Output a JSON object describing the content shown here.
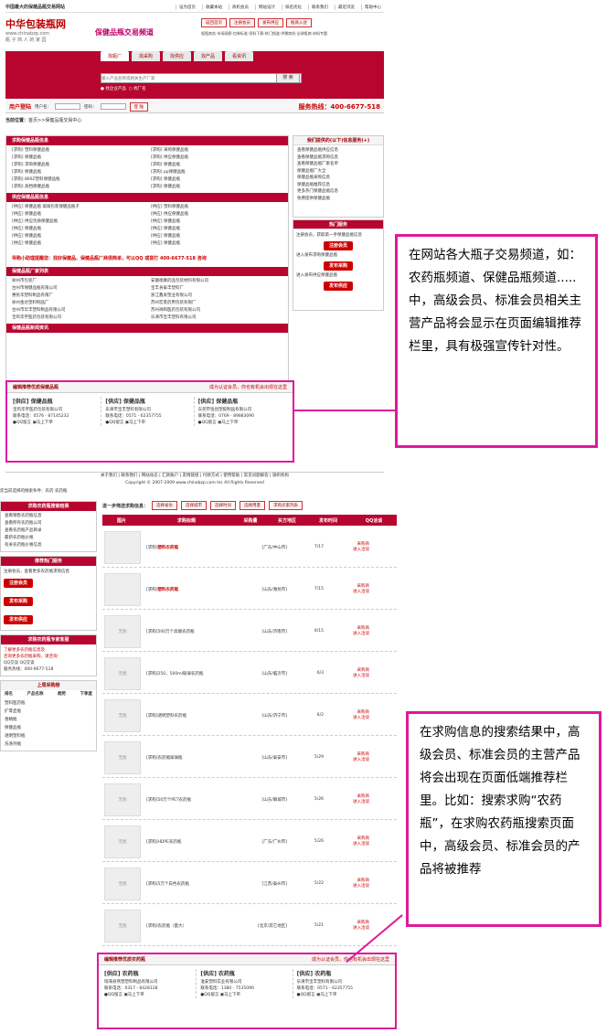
{
  "header": {
    "site_name": "中国最大的保健品瓶交易网站",
    "top_links": [
      "设为首页",
      "收藏本站",
      "商机会员",
      "网站设计",
      "排名优化",
      "联系我们",
      "最近浏览",
      "帮助中心"
    ],
    "logo_title": "中华包装瓶网",
    "logo_url": "www.chinabzp.com",
    "logo_slogan": "瓶 子 商 人 的 家 园",
    "channel": "保健品瓶交易频道",
    "buttons": [
      "返回首页",
      "注册会员",
      "发布供应",
      "瓶商入驻"
    ],
    "links_line": "瓶瓶商务-市场观察-包装标准-资料下载-热门频道-供需商机-全球瓶商-材料专题"
  },
  "nav": {
    "tabs": [
      "找瓶厂",
      "找采购",
      "找供应",
      "找产品",
      "看资讯"
    ],
    "search_placeholder": "输入产品名称或相关生产厂家",
    "search_btn": "搜 索",
    "radio1": "找企业产品",
    "radio2": "找厂名"
  },
  "login": {
    "title": "用户登陆",
    "user_label": "用户名：",
    "pass_label": "密码：",
    "submit": "登 陆",
    "hotline": "服务热线：400-6677-518"
  },
  "crumb": {
    "label": "当前位置：",
    "home": "首页",
    "path": ">>保健品瓶交易中心"
  },
  "sections": {
    "purchase": "求购保健品瓶信息",
    "more": "更多>>",
    "purchase_items": [
      "[求购] 塑料保健品瓶",
      "[求购] 保健品瓶",
      "[求购] 求购保健品瓶",
      "[求购] 保健品瓶",
      "[求购] 800Z塑料保健品瓶",
      "[求购] 高档保健品瓶"
    ],
    "purchase_items_r": [
      "[求购] 采购保健品瓶",
      "[求购] 供应保健品瓶",
      "[求购] 保健品瓶",
      "[求购] pp保健品瓶",
      "[求购] 保健品瓶",
      "[求购] 保健品瓶"
    ],
    "supply": "供应保健品瓶信息",
    "supply_items": [
      "[供应] 保健品瓶 玻璃包装保健品瓶子",
      "[供应] 保健品瓶",
      "[供应] 供应优质保健品瓶",
      "[供应] 保健品瓶",
      "[供应] 保健品瓶",
      "[供应] 保健品瓶"
    ],
    "supply_items_r": [
      "[供应] 塑料保健品瓶",
      "[供应] 供应保健品瓶",
      "[供应] 保健品瓶",
      "[供应] 保健品瓶",
      "[供应] 保健品瓶",
      "[供应] 保健品瓶"
    ],
    "tip": "导购小助理提醒您：找好保健品、保健品瓶厂商很简单，可以QQ",
    "tip2": "或拨打 400-6677-518 咨询",
    "factory": "保健品瓶厂家列表",
    "factories": [
      "徐州市包装厂",
      "台州市保健品瓶有限公司",
      "惠民华塑料制品有限厂",
      "徐州金达塑料制品厂",
      "台州市华丰塑料制品有限公司",
      "宝鸡华宇医药包装有限公司"
    ],
    "factories_r": [
      "安徽德康药品包装材料有限公司",
      "宝丰县泰丰塑料厂",
      "浙江鑫泉塑业有限公司",
      "苏州宏景药用包装有限厂",
      "苏州祥和医药包装有限公司",
      "乐清市宝丰塑料有限公司"
    ],
    "news": "保健品瓶新闻资讯"
  },
  "right": {
    "contact_title": "我们提供的(以下)信息服务(+)",
    "links": [
      "查看保健品瓶供应信息",
      "查看保健品瓶求购信息",
      "查看保健品瓶厂家名单",
      "保健品瓶厂大全",
      "保健品瓶采购信息",
      "保健品瓶推荐信息",
      "更多热门保健品瓶信息",
      "免费提供保健品瓶"
    ],
    "hot_title": "热门服务",
    "reg_text": "注册会员，获取第一手保健品瓶信息",
    "reg_btn": "注册会员",
    "reg_sub": "进入发布求购保健品瓶",
    "pub_btn": "发布采购",
    "pub_sub": "进入发布供应保健品瓶",
    "sup_btn": "发布供应"
  },
  "rec1": {
    "title": "编辑推荐优质保健品瓶",
    "note": "成为认证会员，你也有机会出现在这里",
    "cards": [
      {
        "tag": "[供应]",
        "name": "保健品瓶",
        "company": "宝鸡华宇医药包装有限公司",
        "tel": "联系电话：0576 - 87145232",
        "qq": "QQ留言",
        "order": "马上下单"
      },
      {
        "tag": "[供应]",
        "name": "保健品瓶",
        "company": "乐清市宝丰塑料有限公司",
        "tel": "联系电话：0571 - 62357755",
        "qq": "QQ留言",
        "order": "马上下单"
      },
      {
        "tag": "[供应]",
        "name": "保健品瓶",
        "company": "东莞市恒创塑胶制品有限公司",
        "tel": "联系电话：0769 - 89883090",
        "qq": "QQ留言",
        "order": "马上下单"
      }
    ]
  },
  "note1": "在网站各大瓶子交易频道，如：农药瓶频道、保健品瓶频道.....中，高级会员、标准会员相关主营产品将会显示在页面编辑推荐栏里，具有极强宣传针对性。",
  "note2": "在求购信息的搜索结果中，高级会员、标准会员的主营产品将会出现在页面低端推荐栏里。比如：搜索求购“农药瓶”，在求购农药瓶搜索页面中，高级会员、标准会员的产品将被推荐",
  "footer": {
    "links": "关于我们 | 联系我们 | 网站动态 | 汇款账户 | 友情链接 | 付款方式 | 使用帮助 | 常见问题解答 | 旗帜机构",
    "copy": "Copyright © 2007-2009 www.chinabzp.com Inc All Rights Reserved"
  },
  "search2": {
    "hot": "您当前选择的搜索条件：农药  农药瓶",
    "filter": "进一步筛选求购信息：",
    "selects": [
      "选择省份",
      "选择城市",
      "选择时间",
      "选择用量",
      "求购买家列表"
    ],
    "cols": [
      "图片",
      "求购标题",
      "采购量",
      "买方地区",
      "发布时间",
      "QQ洽谈"
    ],
    "rows": [
      {
        "img": "",
        "title": "[求购]",
        "kw": "塑料农药瓶",
        "addr": "[广东/中山市]",
        "date": "7/17",
        "qq": "采购商\n进入洽谈"
      },
      {
        "img": "",
        "title": "[求购]",
        "kw": "塑料农药瓶",
        "addr": "[山东/潍坊市]",
        "date": "7/15",
        "qq": "采购商\n进入洽谈"
      },
      {
        "img": "无图",
        "title": "[求购]500万个高端农药瓶",
        "kw": "",
        "addr": "[山东/济南市]",
        "date": "6/15",
        "qq": "采购商\n进入洽谈"
      },
      {
        "img": "无图",
        "title": "[求购]250，500ml玻璃农药瓶",
        "kw": "",
        "addr": "[山东/临沂市]",
        "date": "6/3",
        "qq": "采购商\n进入洽谈"
      },
      {
        "img": "无图",
        "title": "[求购]透明塑料农药瓶",
        "kw": "",
        "addr": "[山东/济宁市]",
        "date": "6/2",
        "qq": "采购商\n进入洽谈"
      },
      {
        "img": "无图",
        "title": "[求购]农药瓶玻璃瓶",
        "kw": "",
        "addr": "[山东/泰安市]",
        "date": "5/29",
        "qq": "采购商\n进入洽谈"
      },
      {
        "img": "无图",
        "title": "[求购]50万个PET农药瓶",
        "kw": "",
        "addr": "[山东/聊城市]",
        "date": "5/26",
        "qq": "采购商\n进入洽谈"
      },
      {
        "img": "无图",
        "title": "[求购]HDPE农药瓶",
        "kw": "",
        "addr": "[广东/广州市]",
        "date": "5/26",
        "qq": "采购商\n进入洽谈"
      },
      {
        "img": "无图",
        "title": "[求购]5万个白色农药瓶",
        "kw": "",
        "addr": "[江苏/泰州市]",
        "date": "5/22",
        "qq": "采购商\n进入洽谈"
      },
      {
        "img": "无图",
        "title": "[求购]农药瓶（量大）",
        "kw": "",
        "addr": "[北京/其它地区]",
        "date": "5/21",
        "qq": "采购商\n进入洽谈"
      }
    ]
  },
  "left2": {
    "cat_title": "求购农药瓶搜索结果",
    "cat_links": [
      "查看销售农药瓶信息",
      "查看所有农药瓶公司",
      "查看农药瓶产品目录",
      "最新农药瓶价格",
      "有关农药瓶价格信息"
    ],
    "hot": "推荐热门服务",
    "reg_text": "注册会员，查看更多农药瓶求购信息",
    "reg_btn": "注册会员",
    "pub_btn": "发布采购",
    "sup_btn": "发布供应",
    "expert": "求购农药瓶专家客服",
    "expert_text": "了解更多农药瓶信息及",
    "expert_text2": "咨询更多农药瓶采购，请咨询：",
    "qq1": "QQ交谈",
    "qq2": "QQ交谈",
    "tel": "服务热线：400-6677-518",
    "rank_title": "上周采购榜",
    "rank_cols": [
      "排名",
      "产品名称",
      "趋势",
      "下季度"
    ],
    "ranks": [
      "塑料医药瓶",
      "扩膏壶瓶",
      "香精瓶",
      "保健品瓶",
      "透明塑料瓶",
      "洗涤剂瓶"
    ]
  },
  "rec2": {
    "title": "编辑推荐优质农药瓶",
    "note": "成为认证会员，你也有机会出现在这里",
    "cards": [
      {
        "tag": "[供应]",
        "name": "农药瓶",
        "company": "瑞海县燕塑塑料制品有限公司",
        "tel": "联系电话：0317 - 8428128",
        "qq": "QQ留言",
        "order": "马上下单"
      },
      {
        "tag": "[供应]",
        "name": "农药瓶",
        "company": "淮安塑料实业有限公司",
        "tel": "联系电话：1380 - 7535090",
        "qq": "QQ留言",
        "order": "马上下单"
      },
      {
        "tag": "[供应]",
        "name": "农药瓶",
        "company": "乐清市宝丰塑料有限公司",
        "tel": "联系电话：0571 - 62357755",
        "qq": "QQ留言",
        "order": "马上下单"
      }
    ]
  }
}
